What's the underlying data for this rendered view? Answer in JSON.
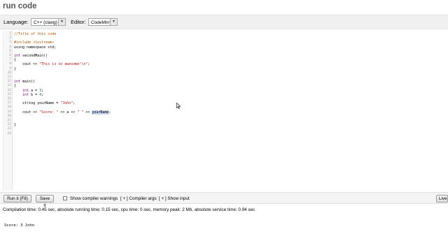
{
  "app": {
    "title": "run code"
  },
  "toolbar": {
    "language_label": "Language:",
    "language_value": "C++ (clang)",
    "editor_label": "Editor:",
    "editor_value": "CodeMirror"
  },
  "editor": {
    "lines": [
      {
        "n": "1",
        "segs": [
          {
            "t": "//Title of this code",
            "c": "comment"
          }
        ]
      },
      {
        "n": "2",
        "segs": []
      },
      {
        "n": "3",
        "segs": [
          {
            "t": "#include <iostream>",
            "c": "comment"
          }
        ]
      },
      {
        "n": "4",
        "segs": [
          {
            "t": "using namespace std;",
            "c": ""
          }
        ]
      },
      {
        "n": "5",
        "segs": []
      },
      {
        "n": "6",
        "segs": [
          {
            "t": "int",
            "c": "kw"
          },
          {
            "t": " secondMain()",
            "c": ""
          }
        ]
      },
      {
        "n": "7",
        "segs": [
          {
            "t": "{",
            "c": ""
          }
        ]
      },
      {
        "n": "8",
        "segs": [
          {
            "t": "    cout << ",
            "c": ""
          },
          {
            "t": "\"This is so awesome!\\n\"",
            "c": "str"
          },
          {
            "t": ";",
            "c": ""
          }
        ]
      },
      {
        "n": "9",
        "segs": [
          {
            "t": "}",
            "c": ""
          }
        ]
      },
      {
        "n": "10",
        "segs": []
      },
      {
        "n": "11",
        "segs": []
      },
      {
        "n": "12",
        "segs": [
          {
            "t": "int",
            "c": "kw"
          },
          {
            "t": " main()",
            "c": ""
          }
        ]
      },
      {
        "n": "13",
        "segs": [
          {
            "t": "{",
            "c": ""
          }
        ]
      },
      {
        "n": "14",
        "segs": [
          {
            "t": "    int",
            "c": "kw"
          },
          {
            "t": " a = ",
            "c": ""
          },
          {
            "t": "3",
            "c": "num"
          },
          {
            "t": ";",
            "c": ""
          }
        ]
      },
      {
        "n": "15",
        "segs": [
          {
            "t": "    int",
            "c": "kw"
          },
          {
            "t": " b = ",
            "c": ""
          },
          {
            "t": "4",
            "c": "num"
          },
          {
            "t": ";",
            "c": ""
          }
        ]
      },
      {
        "n": "16",
        "segs": []
      },
      {
        "n": "17",
        "segs": [
          {
            "t": "    string yourName = ",
            "c": ""
          },
          {
            "t": "\"John\"",
            "c": "str"
          },
          {
            "t": ";",
            "c": ""
          }
        ]
      },
      {
        "n": "18",
        "segs": []
      },
      {
        "n": "19",
        "segs": [
          {
            "t": "    cout << ",
            "c": ""
          },
          {
            "t": "\"Score: \"",
            "c": "str"
          },
          {
            "t": " << a << ",
            "c": ""
          },
          {
            "t": "\" \"",
            "c": "str"
          },
          {
            "t": " << ",
            "c": ""
          },
          {
            "t": "yourName",
            "c": "hl"
          },
          {
            "t": ";",
            "c": ""
          }
        ]
      },
      {
        "n": "20",
        "segs": []
      },
      {
        "n": "21",
        "segs": []
      },
      {
        "n": "22",
        "segs": [
          {
            "t": "}",
            "c": ""
          }
        ]
      },
      {
        "n": "23",
        "segs": []
      },
      {
        "n": "24",
        "segs": []
      }
    ]
  },
  "actions": {
    "run_label": "Run it (F8)",
    "save_label": "Save it",
    "warnings_label": "Show compiler warnings",
    "compiler_args_label": "[ + ] Compiler args",
    "show_input_label": "[ + ] Show input",
    "live_label": "Live"
  },
  "status": {
    "text": "Compilation time: 0.45 sec, absolute running time: 0.15 sec, cpu time: 0 sec, memory peak: 2 Mb, absolute service time: 0.94 sec"
  },
  "output": {
    "text": "Score: 3 John"
  },
  "icons": {
    "cursor": "mouse-pointer-icon"
  }
}
